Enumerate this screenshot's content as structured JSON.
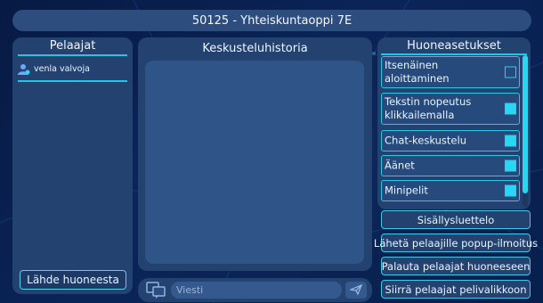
{
  "header": {
    "title": "50125 - Yhteiskuntaoppi 7E"
  },
  "players_panel": {
    "heading": "Pelaajat",
    "players": [
      {
        "name": "venla valvoja",
        "icon": "user-icon"
      }
    ],
    "leave_button": "Lähde huoneesta"
  },
  "chat_panel": {
    "heading": "Keskusteluhistoria"
  },
  "message_bar": {
    "placeholder": "Viesti",
    "chat_icon": "chat-bubble-icon",
    "send_icon": "paper-plane-icon"
  },
  "settings_panel": {
    "heading": "Huoneasetukset",
    "items": [
      {
        "label": "Itsenäinen aloittaminen",
        "checked": false
      },
      {
        "label": "Tekstin nopeutus klikkailemalla",
        "checked": true
      },
      {
        "label": "Chat-keskustelu",
        "checked": true
      },
      {
        "label": "Äänet",
        "checked": true
      },
      {
        "label": "Minipelit",
        "checked": true
      }
    ]
  },
  "actions": {
    "contents": "Sisällysluettelo",
    "popup": "Lähetä pelaajille popup-ilmoitus",
    "return": "Palauta pelaajat huoneeseen",
    "move": "Siirrä pelaajat pelivalikkoon"
  },
  "colors": {
    "accent": "#2ad6f2",
    "panel": "#23426f",
    "background": "#0a2458"
  }
}
